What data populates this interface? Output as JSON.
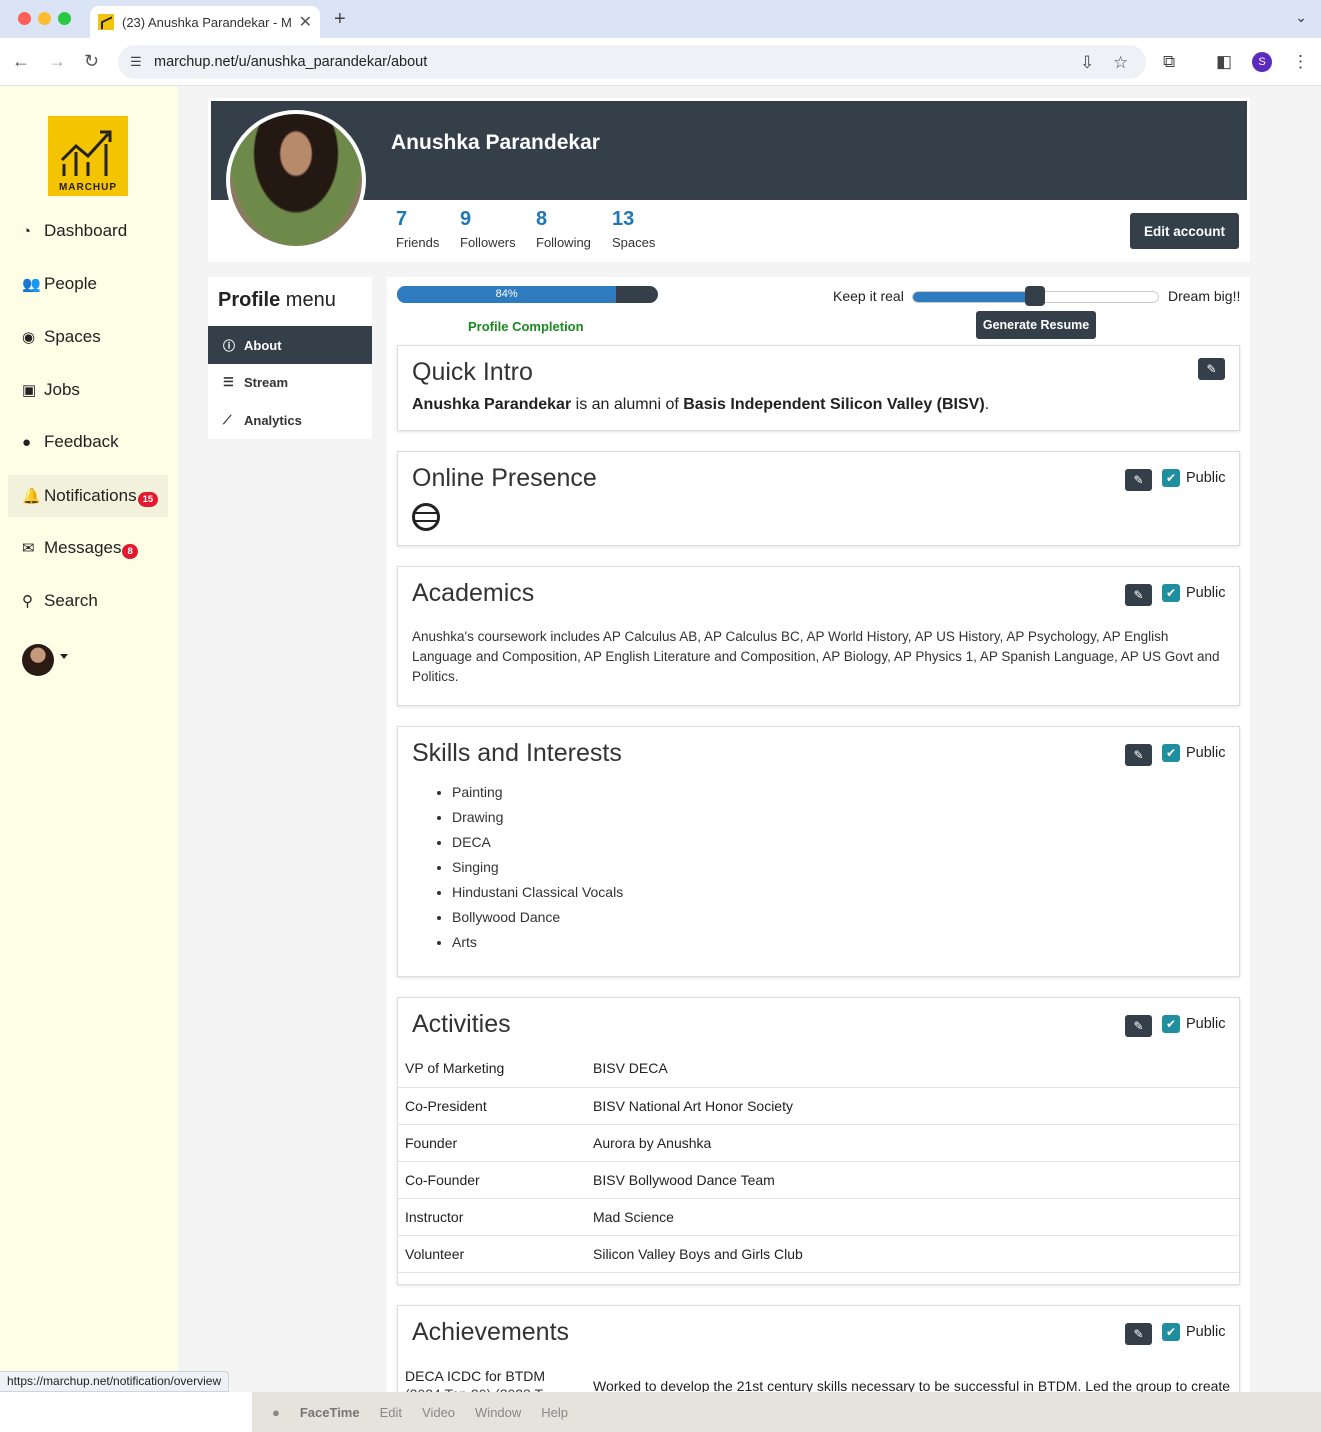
{
  "browser": {
    "tab_title": "(23) Anushka Parandekar - M",
    "url": "marchup.net/u/anushka_parandekar/about",
    "status_url": "https://marchup.net/notification/overview",
    "profile_initial": "S"
  },
  "sidebar": {
    "logo_text": "MARCHUP",
    "items": [
      {
        "label": "Dashboard",
        "icon": "dashboard-icon"
      },
      {
        "label": "People",
        "icon": "people-icon"
      },
      {
        "label": "Spaces",
        "icon": "spaces-icon"
      },
      {
        "label": "Jobs",
        "icon": "briefcase-icon"
      },
      {
        "label": "Feedback",
        "icon": "comment-icon"
      },
      {
        "label": "Notifications",
        "icon": "bell-icon",
        "badge": "15"
      },
      {
        "label": "Messages",
        "icon": "envelope-icon",
        "badge": "8"
      },
      {
        "label": "Search",
        "icon": "search-icon"
      }
    ]
  },
  "profile": {
    "name": "Anushka Parandekar",
    "stats": [
      {
        "value": "7",
        "label": "Friends"
      },
      {
        "value": "9",
        "label": "Followers"
      },
      {
        "value": "8",
        "label": "Following"
      },
      {
        "value": "13",
        "label": "Spaces"
      }
    ],
    "edit_label": "Edit account"
  },
  "profile_menu": {
    "title_bold": "Profile",
    "title_rest": " menu",
    "items": [
      "About",
      "Stream",
      "Analytics"
    ]
  },
  "completion": {
    "percent_label": "84%",
    "percent": 84,
    "label": "Profile Completion"
  },
  "slider": {
    "left_label": "Keep it real",
    "right_label": "Dream big!!",
    "level": 0.5,
    "button": "Generate Resume"
  },
  "public_label": "Public",
  "quick_intro": {
    "title": "Quick Intro",
    "name": "Anushka Parandekar",
    "mid": " is an alumni of ",
    "school": "Basis Independent Silicon Valley (BISV)",
    "end": "."
  },
  "online_presence": {
    "title": "Online Presence"
  },
  "academics": {
    "title": "Academics",
    "text": "Anushka's coursework includes AP Calculus AB, AP Calculus BC, AP World History, AP US History, AP Psychology, AP English Language and Composition, AP English Literature and Composition, AP Biology, AP Physics 1, AP Spanish Language, AP US Govt and Politics."
  },
  "skills": {
    "title": "Skills and Interests",
    "items": [
      "Painting",
      "Drawing",
      "DECA",
      "Singing",
      "Hindustani Classical Vocals",
      "Bollywood Dance",
      "Arts"
    ]
  },
  "activities": {
    "title": "Activities",
    "rows": [
      [
        "VP of Marketing",
        "BISV DECA"
      ],
      [
        "Co-President",
        "BISV National Art Honor Society"
      ],
      [
        "Founder",
        "Aurora by Anushka"
      ],
      [
        "Co-Founder",
        "BISV Bollywood Dance Team"
      ],
      [
        "Instructor",
        "Mad Science"
      ],
      [
        "Volunteer",
        "Silicon Valley Boys and Girls Club"
      ]
    ]
  },
  "achievements": {
    "title": "Achievements",
    "item_title": "DECA ICDC for BTDM",
    "item_sub": "(2024 Top 20) (2023 T",
    "item_desc": "Worked to develop the 21st century skills necessary to be successful in BTDM. Led the group to create"
  },
  "mac_menu": [
    "FaceTime",
    "Edit",
    "Video",
    "Window",
    "Help"
  ]
}
